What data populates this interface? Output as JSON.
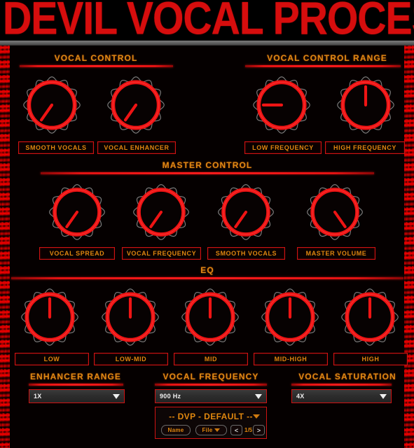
{
  "app": {
    "title": "DEVIL VOCAL PROCESSOR"
  },
  "sections": {
    "vocal_control": {
      "title": "VOCAL CONTROL",
      "knobs": [
        {
          "label": "SMOOTH VOCALS",
          "angle": 215
        },
        {
          "label": "VOCAL ENHANCER",
          "angle": 215
        }
      ]
    },
    "vocal_control_range": {
      "title": "VOCAL CONTROL RANGE",
      "knobs": [
        {
          "label": "LOW FREQUENCY",
          "angle": 270
        },
        {
          "label": "HIGH FREQUENCY",
          "angle": 0
        }
      ]
    },
    "master_control": {
      "title": "MASTER CONTROL",
      "knobs": [
        {
          "label": "VOCAL SPREAD",
          "angle": 215
        },
        {
          "label": "VOCAL FREQUENCY",
          "angle": 215
        },
        {
          "label": "SMOOTH VOCALS",
          "angle": 215
        },
        {
          "label": "MASTER VOLUME",
          "angle": 145
        }
      ]
    },
    "eq": {
      "title": "EQ",
      "knobs": [
        {
          "label": "LOW",
          "angle": 0
        },
        {
          "label": "LOW-MID",
          "angle": 0
        },
        {
          "label": "MID",
          "angle": 0
        },
        {
          "label": "MID-HIGH",
          "angle": 0
        },
        {
          "label": "HIGH",
          "angle": 0
        }
      ]
    },
    "enhancer_range": {
      "title": "ENHANCER RANGE",
      "value": "1X"
    },
    "vocal_frequency": {
      "title": "VOCAL FREQUENCY",
      "value": "900 Hz"
    },
    "vocal_saturation": {
      "title": "VOCAL SATURATION",
      "value": "4X"
    }
  },
  "preset_browser": {
    "preset_name": "-- DVP - DEFAULT --",
    "name_button": "Name",
    "file_button": "File",
    "prev_button": "<",
    "next_button": ">",
    "page": "1/5"
  },
  "colors": {
    "accent_red": "#e21212",
    "title_red": "#d60d0d",
    "label_orange": "#e0870f",
    "background": "#000000"
  },
  "icons": {
    "dropdown": "chevron-down-icon",
    "preset_caret": "caret-down-icon",
    "prev": "prev-arrow-icon",
    "next": "next-arrow-icon"
  }
}
